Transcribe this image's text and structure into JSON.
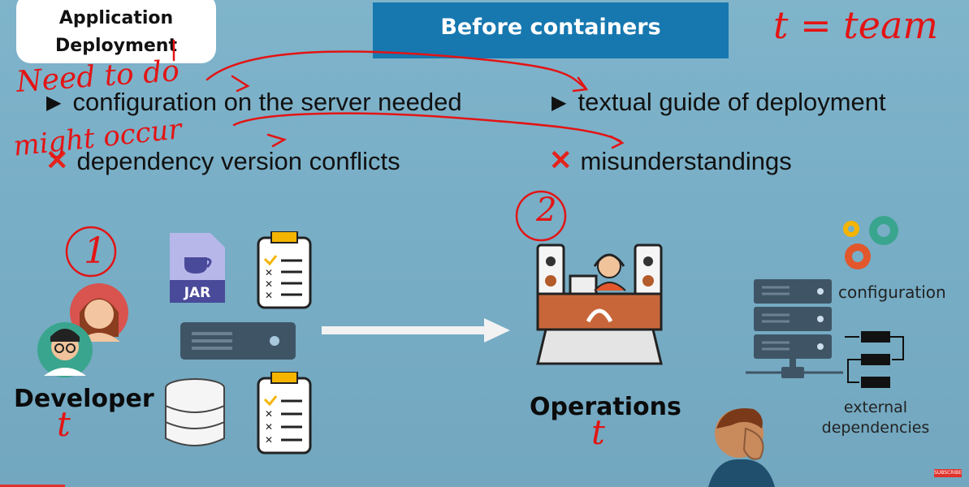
{
  "header": {
    "section_title": "Application Deployment",
    "banner_title": "Before containers"
  },
  "bullets": {
    "left_1": "configuration on the server needed",
    "right_1": "textual guide of deployment",
    "left_2": "dependency version conflicts",
    "right_2": "misunderstandings"
  },
  "actors": {
    "developer": "Developer",
    "operations": "Operations"
  },
  "server_labels": {
    "configuration": "configuration",
    "external_line1": "external",
    "external_line2": "dependencies"
  },
  "annotations": {
    "t_team": "t = team",
    "need_to_do": "Need to do",
    "might_occur": "might occur",
    "num_1": "1",
    "num_2": "2",
    "t_dev": "t",
    "t_ops": "t"
  },
  "icons": {
    "jar_label": "JAR",
    "subscribe": "SUBSCRIBE"
  },
  "colors": {
    "banner": "#1778b0",
    "background": "#7fb4cb",
    "cross": "#e5221b",
    "annotation": "#e31414"
  }
}
